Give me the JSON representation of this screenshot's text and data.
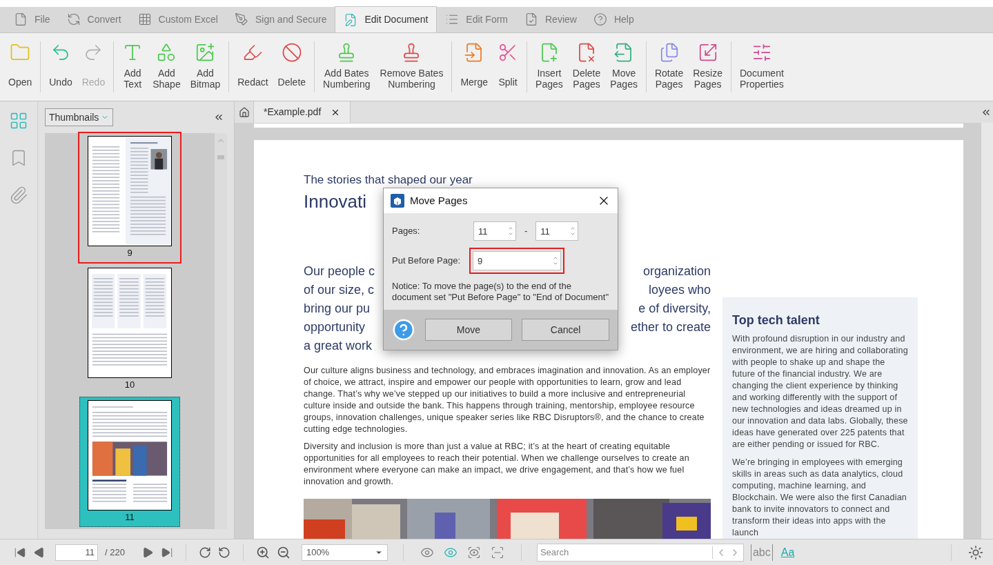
{
  "tabs": [
    {
      "label": "File",
      "kind": "file",
      "selected": false
    },
    {
      "label": "Convert",
      "kind": "convert",
      "selected": false
    },
    {
      "label": "Custom Excel",
      "kind": "excel",
      "selected": false
    },
    {
      "label": "Sign and Secure",
      "kind": "sign",
      "selected": false
    },
    {
      "label": "Edit Document",
      "kind": "edit",
      "selected": true
    },
    {
      "label": "Edit Form",
      "kind": "form",
      "selected": false
    },
    {
      "label": "Review",
      "kind": "review",
      "selected": false
    },
    {
      "label": "Help",
      "kind": "help",
      "selected": false
    }
  ],
  "ribbon": [
    [
      {
        "lines": [
          "Open"
        ],
        "kind": "open",
        "disabled": false
      }
    ],
    [
      {
        "lines": [
          "Undo"
        ],
        "kind": "undo",
        "disabled": false
      },
      {
        "lines": [
          "Redo"
        ],
        "kind": "redo",
        "disabled": true
      }
    ],
    [
      {
        "lines": [
          "Add",
          "Text"
        ],
        "kind": "add-text",
        "disabled": false
      },
      {
        "lines": [
          "Add",
          "Shape"
        ],
        "kind": "add-shape",
        "disabled": false
      },
      {
        "lines": [
          "Add",
          "Bitmap"
        ],
        "kind": "add-bitmap",
        "disabled": false
      }
    ],
    [
      {
        "lines": [
          "Redact"
        ],
        "kind": "redact",
        "disabled": false
      },
      {
        "lines": [
          "Delete"
        ],
        "kind": "delete",
        "disabled": false
      }
    ],
    [
      {
        "lines": [
          "Add Bates",
          "Numbering"
        ],
        "kind": "add-bates",
        "disabled": false
      },
      {
        "lines": [
          "Remove Bates",
          "Numbering"
        ],
        "kind": "remove-bates",
        "disabled": false
      }
    ],
    [
      {
        "lines": [
          "Merge"
        ],
        "kind": "merge",
        "disabled": false
      },
      {
        "lines": [
          "Split"
        ],
        "kind": "split",
        "disabled": false
      }
    ],
    [
      {
        "lines": [
          "Insert",
          "Pages"
        ],
        "kind": "insert-pages",
        "disabled": false
      },
      {
        "lines": [
          "Delete",
          "Pages"
        ],
        "kind": "delete-pages",
        "disabled": false
      },
      {
        "lines": [
          "Move",
          "Pages"
        ],
        "kind": "move-pages",
        "disabled": false
      }
    ],
    [
      {
        "lines": [
          "Rotate",
          "Pages"
        ],
        "kind": "rotate-pages",
        "disabled": false
      },
      {
        "lines": [
          "Resize",
          "Pages"
        ],
        "kind": "resize-pages",
        "disabled": false
      }
    ],
    [
      {
        "lines": [
          "Document",
          "Properties"
        ],
        "kind": "properties",
        "disabled": false
      }
    ]
  ],
  "left_rail": [
    {
      "kind": "thumbnails",
      "selected": true
    },
    {
      "kind": "bookmarks",
      "selected": false
    },
    {
      "kind": "attachments",
      "selected": false
    }
  ],
  "thumbnail_panel": {
    "view_menu": "Thumbnails",
    "pages": [
      {
        "label": "9",
        "kind": "text-photo",
        "selected": false,
        "highlighted": true
      },
      {
        "label": "10",
        "kind": "text-columns",
        "selected": false,
        "highlighted": false
      },
      {
        "label": "11",
        "kind": "photo-feature",
        "selected": true,
        "highlighted": false
      }
    ]
  },
  "document_tabs": [
    {
      "label": "*Example.pdf",
      "selected": true
    }
  ],
  "page": {
    "eyebrow": "The stories that shaped our year",
    "title": "Innovati",
    "intro_lines": [
      {
        "left": "Our people c",
        "right": "organization"
      },
      {
        "left": "of our size, c",
        "right": "loyees who"
      },
      {
        "left": "bring our pu",
        "right": "e of diversity,"
      },
      {
        "left": "opportunity",
        "right": "ether to create"
      },
      {
        "left": "a great work"
      }
    ],
    "paragraphs": [
      "Our culture aligns business and technology, and embraces imagination and innovation. As an employer of choice, we attract, inspire and empower our people with opportunities to learn, grow and lead change. That’s why we’ve stepped up our initiatives to build a more inclusive and entrepreneurial culture inside and outside the bank. This happens through training, mentorship, employee resource groups, innovation challenges, unique speaker series like RBC Disruptors®, and the chance to create cutting edge technologies.",
      "Diversity and inclusion is more than just a value at RBC; it’s at the heart of creating equitable opportunities for all employees to reach their potential. When we challenge ourselves to create an environment where everyone can make an impact, we drive engagement, and that’s how we fuel innovation and growth."
    ],
    "sidebar": {
      "heading": "Top tech talent",
      "paragraphs": [
        "With profound disruption in our industry and environment, we are hiring and collaborating with people to shake up and shape the future of the financial industry. We are changing the client experience by thinking and working differently with the support of new technologies and ideas dreamed up in our innovation and data labs. Globally, these ideas have generated over 225 patents that are either pending or issued for RBC.",
        "We’re bringing in employees with emerging skills in areas such as data analytics, cloud computing, machine learning, and Blockchain. We were also the first Canadian bank to invite innovators to connect and transform their ideas into apps with the launch"
      ]
    }
  },
  "dialog": {
    "title": "Move Pages",
    "pages_label": "Pages:",
    "pages_from": "11",
    "range_separator": "-",
    "pages_to": "11",
    "put_before_label": "Put Before Page:",
    "put_before_value": "9",
    "put_before_highlighted": true,
    "notice": "Notice: To move the page(s) to the end of the document set \"Put Before Page\" to \"End of Document\"",
    "buttons": [
      "Move",
      "Cancel"
    ]
  },
  "status_bar": {
    "page_value": "11",
    "page_total": "/ 220",
    "zoom": "100%",
    "view_modes": [
      {
        "selected": false
      },
      {
        "selected": true
      },
      {
        "selected": false
      },
      {
        "selected": false
      }
    ],
    "search_placeholder": "Search",
    "toggles": [
      {
        "label": "abc",
        "on": false
      },
      {
        "label": "Aa",
        "on": true
      }
    ]
  }
}
